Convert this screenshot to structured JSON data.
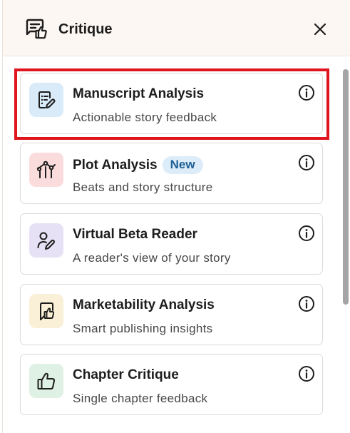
{
  "header": {
    "title": "Critique",
    "icon": "critique-icon",
    "close_icon": "close-icon"
  },
  "cards": [
    {
      "title": "Manuscript Analysis",
      "subtitle": "Actionable story feedback",
      "icon": "manuscript-edit-icon",
      "icon_bg": "#d9ebf8",
      "selected": true
    },
    {
      "title": "Plot Analysis",
      "badge": "New",
      "subtitle": "Beats and story structure",
      "icon": "plot-chart-icon",
      "icon_bg": "#fbdcdc"
    },
    {
      "title": "Virtual Beta Reader",
      "subtitle": "A reader's view of your story",
      "icon": "reader-edit-icon",
      "icon_bg": "#e7e1f5"
    },
    {
      "title": "Marketability Analysis",
      "subtitle": "Smart publishing insights",
      "icon": "bookmark-thumbs-icon",
      "icon_bg": "#faefd7"
    },
    {
      "title": "Chapter Critique",
      "subtitle": "Single chapter feedback",
      "icon": "thumbs-up-icon",
      "icon_bg": "#dff0e4"
    }
  ],
  "colors": {
    "highlight": "#e0141e",
    "badge_bg": "#dcecf9",
    "badge_text": "#1e5f95",
    "header_bg": "#fdf7f3"
  }
}
